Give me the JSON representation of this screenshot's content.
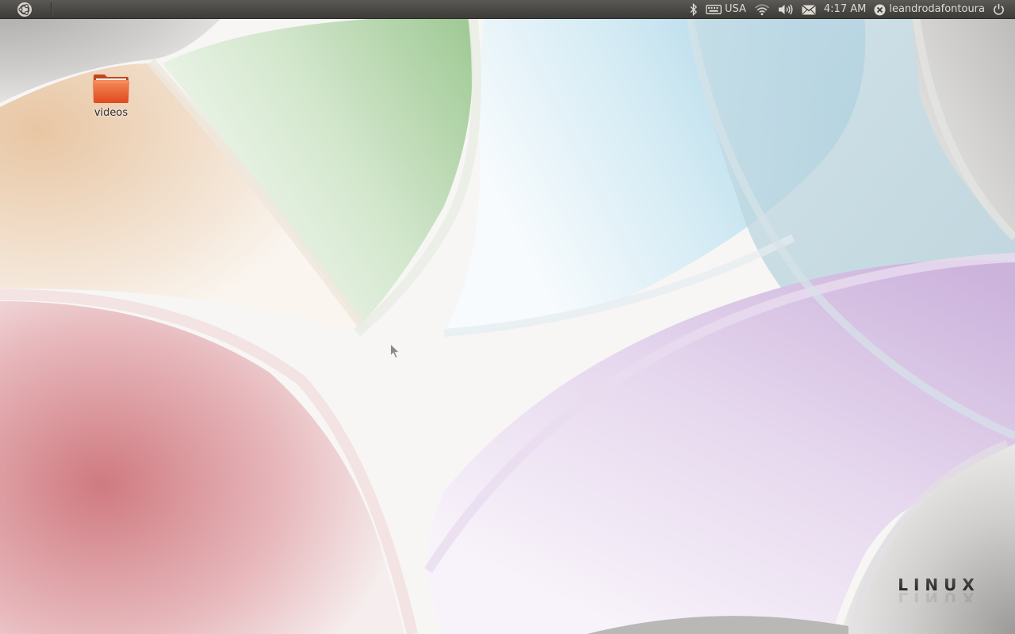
{
  "panel": {
    "keyboard_layout": "USA",
    "clock": "4:17 AM",
    "username": "leandrodafontoura",
    "icons": {
      "launcher": "ubuntu-logo-icon",
      "bluetooth": "bluetooth-icon",
      "keyboard": "keyboard-icon",
      "network": "wifi-icon",
      "sound": "volume-icon",
      "messages": "envelope-icon",
      "user_status": "user-status-icon",
      "session": "power-icon"
    }
  },
  "desktop": {
    "icons": [
      {
        "label": "videos",
        "icon": "folder-icon"
      }
    ],
    "watermark": "LINUX"
  },
  "colors": {
    "panel": "#3c3b37",
    "panel_text": "#dfdbd2",
    "folder_orange": "#e8562c"
  }
}
